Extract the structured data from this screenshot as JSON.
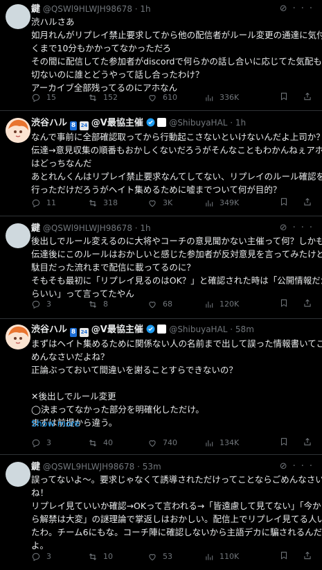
{
  "tweets": [
    {
      "name": "鍵",
      "handle": "@QSWl9HLWJH98678",
      "time": "· 1h",
      "text": "渋ハルさあ\n如月れんがリプレイ禁止要求してから他の配信者がルール変更の通達に気付\nくまで10分もかかってなかっただろ\nその間に配信してた参加者がdiscordで何らかの話し合いに応じてた気配も一\n切ないのに誰とどうやって話し合ったわけ？\nアーカイブ全部残ってるのにアホなん",
      "replies": "15",
      "reposts": "152",
      "likes": "610",
      "views": "336K"
    },
    {
      "name": "渋谷ハル",
      "badge_number": "8",
      "badge_cal": "24",
      "name_suffix": "@V最協主催",
      "handle": "@ShibuyaHAL",
      "time": "· 1h",
      "text": "なんで事前に全部確認取ってから行動起こさないといけないんだよ上司か？\n伝達→意見収集の順番もおかしくないだろうがそんなこともわかんねぇアホ\nはどっちなんだ\nあとれんくんはリプレイ禁止要求なんてしてない、リプレイのルール確認を\n行っただけだろうがヘイト集めるために嘘までついて何が目的？",
      "replies": "11",
      "reposts": "318",
      "likes": "3K",
      "views": "349K"
    },
    {
      "name": "鍵",
      "handle": "@QSWl9HLWJH98678",
      "time": "· 1h",
      "text": "後出しでルール変えるのに大将やコーチの意見聞かない主催って何？しかも\n伝達後にこのルールはおかしいと感じた参加者が反対意見を言ってみたけど\n駄目だった流れまで配信に載ってるのに？\nそもそも最初に「リプレイ見るのはOK？」と確認された時は「公開情報だか\nらいい」って言ってたやん",
      "replies": "3",
      "reposts": "8",
      "likes": "68",
      "views": "120K"
    },
    {
      "name": "渋谷ハル",
      "badge_number": "8",
      "badge_cal": "24",
      "name_suffix": "@V最協主催",
      "handle": "@ShibuyaHAL",
      "time": "· 58m",
      "text": "まずはヘイト集めるために関係ない人の名前まで出して誤った情報書いてご\nめんなさいだよね？\n正論ぶっておいて間違いを謝ることすらできないの？\n\n✕後出しでルール変更\n◯決まってなかった部分を明確化しただけ。\nまずは前提から違う。",
      "show_more": "Show more",
      "replies": "3",
      "reposts": "40",
      "likes": "740",
      "views": "134K"
    },
    {
      "name": "鍵",
      "handle": "@QSWL9HLWJH98678",
      "time": "· 53m",
      "text": "誤ってないよ～。要求じゃなくて誘導されただけってことならごめんなさい\nね！\nリプレイ見ていいか確認→OKって言われる→「皆遠慮して見てない」「今か\nら解禁は大変」の謎理論で掌返しはおかしい。配信上でリプレイ見てる人い\nたわ。チーム6にもな。コーチ陣に確認しないから主語デカに騙されるんだ\nよ。",
      "replies": "3",
      "reposts": "10",
      "likes": "53",
      "views": "110K"
    }
  ],
  "icons": {
    "reply": "reply-icon",
    "repost": "repost-icon",
    "like": "heart-icon",
    "views": "views-icon",
    "bookmark": "bookmark-icon",
    "share": "share-icon",
    "grok": "grok-icon",
    "more": "more-icon"
  },
  "colors": {
    "background": "#000000",
    "text": "#e7e9ea",
    "muted": "#71767b",
    "link": "#1d9bf0",
    "verified": "#1d9bf0"
  }
}
